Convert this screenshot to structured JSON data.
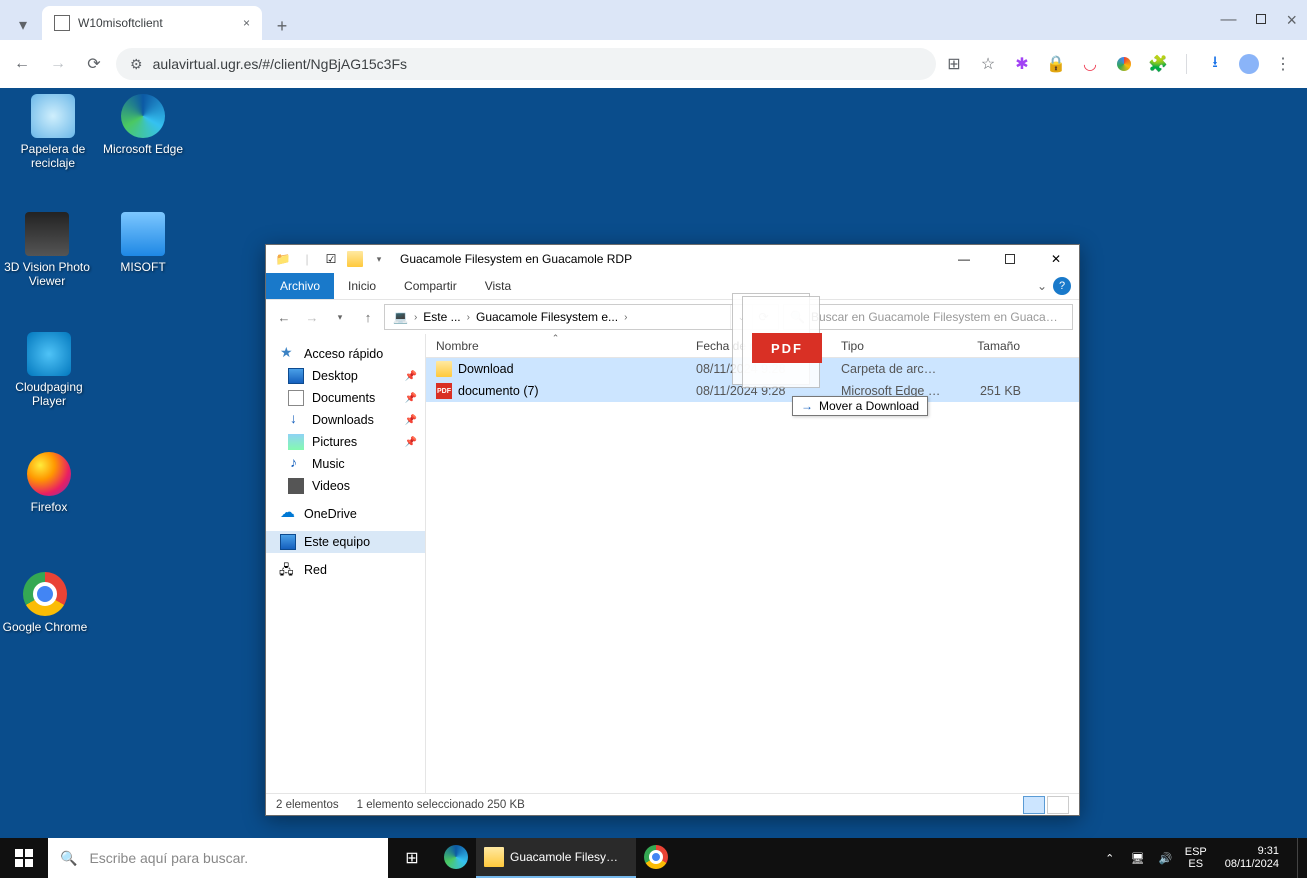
{
  "browser": {
    "tab_title": "W10misoftclient",
    "url": "aulavirtual.ugr.es/#/client/NgBjAG15c3Fs",
    "new_tab": "+",
    "close": "×",
    "minimize": "—",
    "maximize": "▢"
  },
  "desktop_icons": [
    {
      "label": "Papelera de reciclaje"
    },
    {
      "label": "Microsoft Edge"
    },
    {
      "label": "3D Vision Photo Viewer"
    },
    {
      "label": "MISOFT"
    },
    {
      "label": "Cloudpaging Player"
    },
    {
      "label": "Firefox"
    },
    {
      "label": "Google Chrome"
    }
  ],
  "explorer": {
    "title": "Guacamole Filesystem en Guacamole RDP",
    "tabs": {
      "archivo": "Archivo",
      "inicio": "Inicio",
      "compartir": "Compartir",
      "vista": "Vista"
    },
    "breadcrumb": {
      "seg1": "Este ...",
      "seg2": "Guacamole Filesystem e..."
    },
    "search_placeholder": "Buscar en Guacamole Filesystem en Guacamole RDP",
    "columns": {
      "nombre": "Nombre",
      "fecha": "Fecha de modificación",
      "tipo": "Tipo",
      "tamano": "Tamaño"
    },
    "sidebar": {
      "quick": "Acceso rápido",
      "desktop": "Desktop",
      "documents": "Documents",
      "downloads": "Downloads",
      "pictures": "Pictures",
      "music": "Music",
      "videos": "Videos",
      "onedrive": "OneDrive",
      "thispc": "Este equipo",
      "network": "Red"
    },
    "rows": [
      {
        "name": "Download",
        "date": "08/11/2024 9:28",
        "type": "Carpeta de archivos",
        "size": "",
        "icon": "folder"
      },
      {
        "name": "documento (7)",
        "date": "08/11/2024 9:28",
        "type": "Microsoft Edge P...",
        "size": "251 KB",
        "icon": "pdf"
      }
    ],
    "drag": {
      "badge": "PDF",
      "tooltip": "Mover a Download"
    },
    "status": {
      "count": "2 elementos",
      "selection": "1 elemento seleccionado  250 KB"
    }
  },
  "taskbar": {
    "search_placeholder": "Escribe aquí para buscar.",
    "app_explorer": "Guacamole Filesyst...",
    "lang1": "ESP",
    "lang2": "ES",
    "time": "9:31",
    "date": "08/11/2024"
  }
}
